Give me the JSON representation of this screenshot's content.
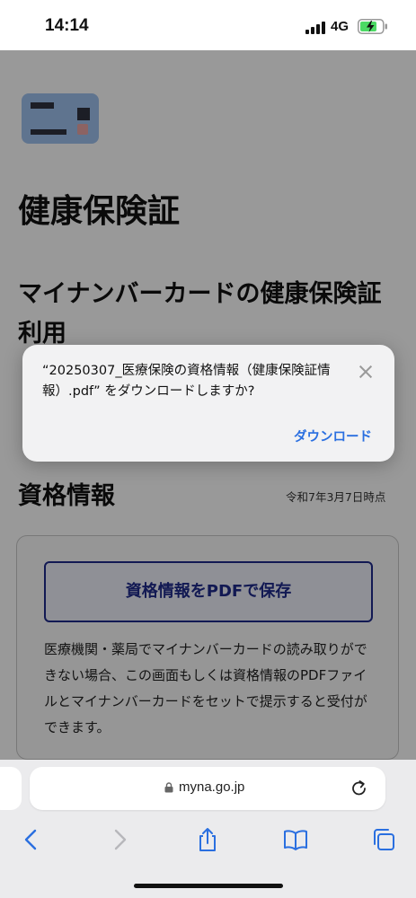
{
  "status": {
    "time": "14:14",
    "network": "4G"
  },
  "page": {
    "title": "健康保険証",
    "subtitle": "マイナンバーカードの健康保険証利用",
    "section_title": "資格情報",
    "date_note": "令和7年3月7日時点",
    "pdf_button": "資格情報をPDFで保存",
    "description": "医療機関・薬局でマイナンバーカードの読み取りができない場合、この画面もしくは資格情報のPDFファイルとマイナンバーカードをセットで提示すると受付ができます。"
  },
  "dialog": {
    "message": "“20250307_医療保険の資格情報（健康保険証情報）.pdf” をダウンロードしますか?",
    "download_label": "ダウンロード"
  },
  "browser": {
    "url": "myna.go.jp"
  },
  "icons": {
    "card": "id-card-icon",
    "close": "close-icon",
    "lock": "lock-icon",
    "reload": "reload-icon",
    "back": "back-chevron-icon",
    "forward": "forward-chevron-icon",
    "share": "share-icon",
    "bookmarks": "book-icon",
    "tabs": "tabs-icon"
  },
  "colors": {
    "accent": "#2a6fe0",
    "button_border": "#1f2a8a"
  }
}
